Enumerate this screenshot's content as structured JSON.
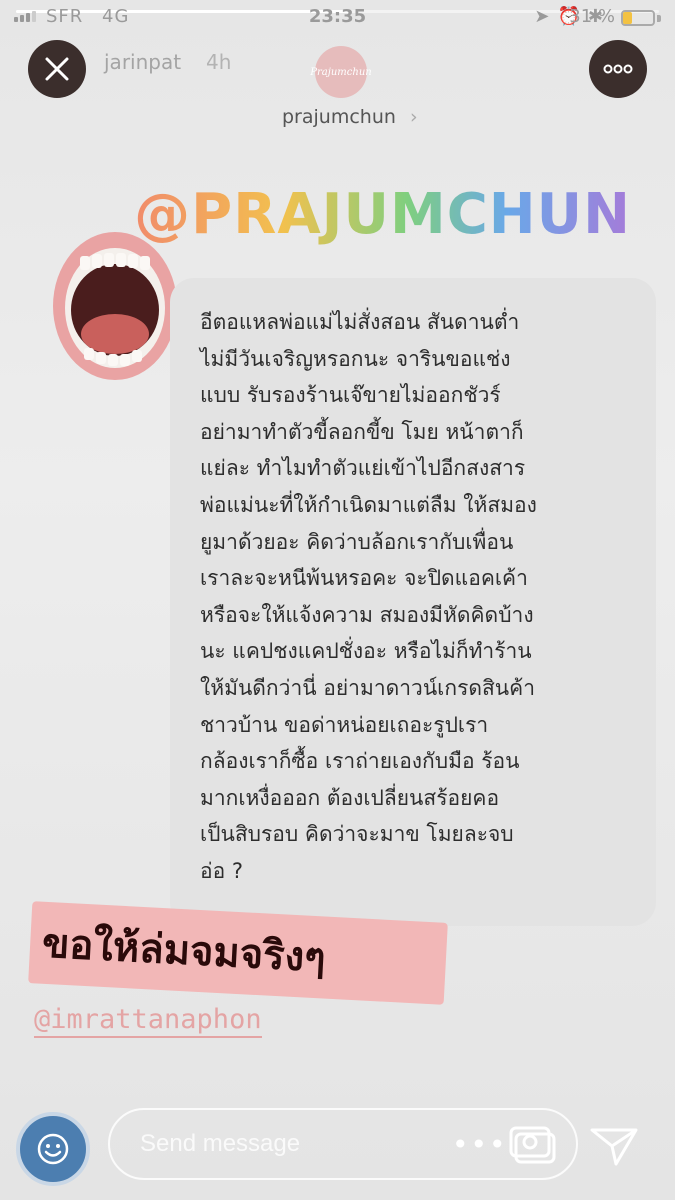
{
  "status_bar": {
    "carrier": "SFR",
    "network": "4G",
    "time": "23:35",
    "battery_percent": "31 %",
    "battery_level": 0.31
  },
  "story": {
    "progress": 0.52,
    "username": "jarinpat",
    "time_ago": "4h",
    "close_icon": "close-icon",
    "menu_icon": "more-icon"
  },
  "brand": {
    "logo_text": "Prajumchun",
    "handle": "prajumchun",
    "chevron": "›"
  },
  "mention_top": "@PRAJUMCHUN",
  "message_lines": [
    "อีตอแหลพ่อแม่ไม่สั่งสอน สันดานต่ำ",
    "ไม่มีวันเจริญหรอกนะ จารินขอแช่ง",
    "แบบ รับรองร้านเจ๊ขายไม่ออกชัวร์",
    "อย่ามาทำตัวขี้ลอกขี้ข โมย หน้าตาก็",
    "แย่ละ ทำไมทำตัวแย่เข้าไปอีกสงสาร",
    "พ่อแม่นะที่ให้กำเนิดมาแต่ลืม ให้สมอง",
    "ยูมาด้วยอะ คิดว่าบล้อกเรากับเพื่อน",
    "เราละจะหนีพ้นหรอคะ จะปิดแอคเค้า",
    "หรือจะให้แจ้งความ สมองมีหัดคิดบ้าง",
    "นะ แคปชงแคปชั่งอะ หรือไม่ก็ทำร้าน",
    "ให้มันดีกว่านี่ อย่ามาดาวน์เกรดสินค้า",
    "ชาวบ้าน ขอด่าหน่อยเถอะรูปเรา",
    "กล้องเราก็ซื้อ เราถ่ายเองกับมือ ร้อน",
    "มากเหงื่อออก ต้องเปลี่ยนสร้อยคอ",
    "เป็นสิบรอบ คิดว่าจะมาข โมยละจบ",
    "อ่อ ?"
  ],
  "sticker_text": "ขอให้ล่มจมจริงๆ",
  "mention_bottom": "@imrattanaphon",
  "bottom_bar": {
    "send_placeholder": "Send message",
    "more_dots": "•••",
    "camera_icon": "camera-icon",
    "gallery_icon": "gallery-icon",
    "share_icon": "direct-share-icon"
  },
  "colors": {
    "background": "#e9e9e9",
    "card": "#e3e3e3",
    "sticker": "#f2b7b7",
    "mention_bottom": "#e4a4a4",
    "camera_button": "#4c7eb0",
    "round_button": "#3b2e2c"
  }
}
